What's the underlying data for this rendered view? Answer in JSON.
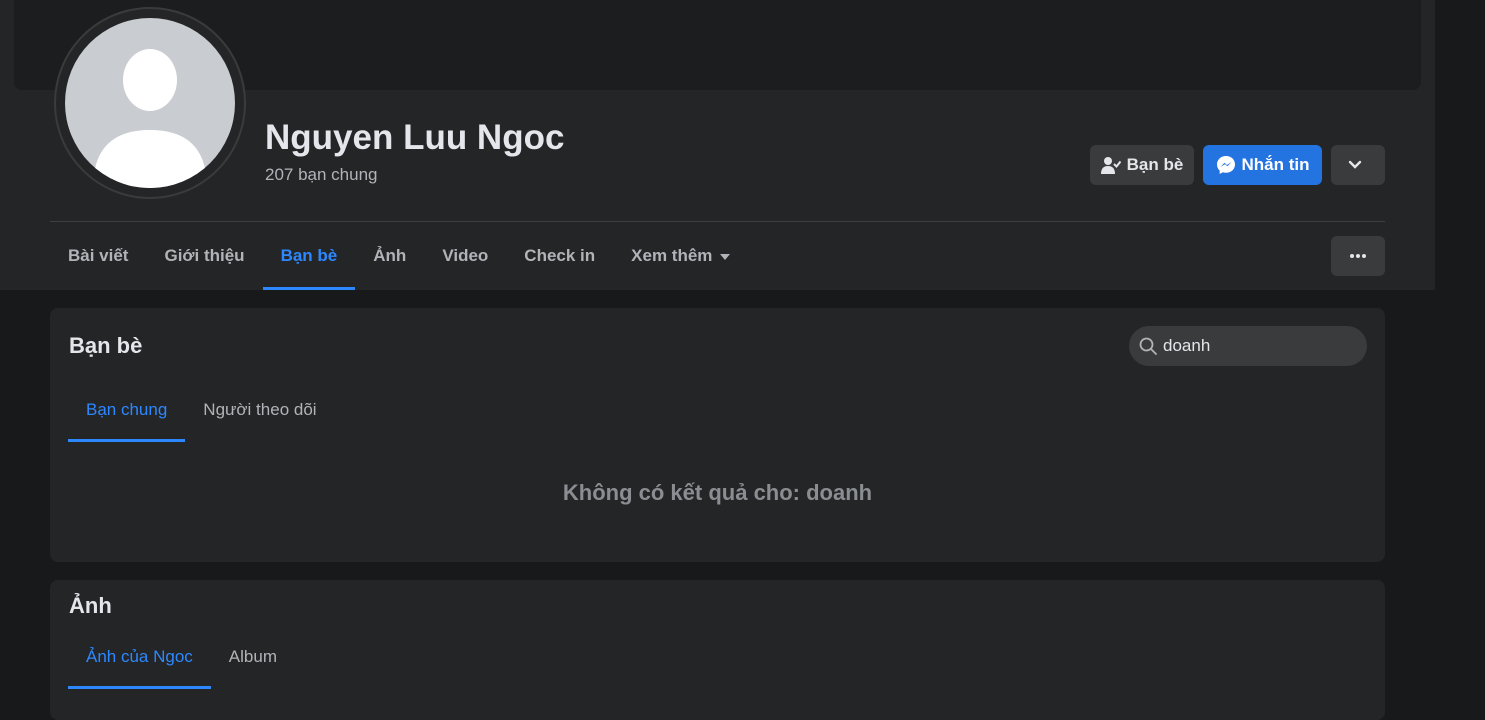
{
  "profile": {
    "name": "Nguyen Luu Ngoc",
    "mutual_friends": "207 bạn chung"
  },
  "actions": {
    "friends_label": "Bạn bè",
    "message_label": "Nhắn tin",
    "friends_icon": "user-check-icon",
    "message_icon": "messenger-icon",
    "more_icon": "chevron-down-icon",
    "accent_color": "#2374e1"
  },
  "nav": {
    "tabs": [
      {
        "label": "Bài viết"
      },
      {
        "label": "Giới thiệu"
      },
      {
        "label": "Bạn bè"
      },
      {
        "label": "Ảnh"
      },
      {
        "label": "Video"
      },
      {
        "label": "Check in"
      },
      {
        "label": "Xem thêm"
      }
    ],
    "active_tab": "Bạn bè",
    "overflow_icon": "more-dots-icon"
  },
  "friends_section": {
    "title": "Bạn bè",
    "search": {
      "value": "doanh",
      "icon": "search-icon"
    },
    "tabs": [
      {
        "label": "Bạn chung"
      },
      {
        "label": "Người theo dõi"
      }
    ],
    "active_tab": "Bạn chung",
    "no_results": "Không có kết quả cho: doanh"
  },
  "photos_section": {
    "title": "Ảnh",
    "tabs": [
      {
        "label": "Ảnh của Ngoc"
      },
      {
        "label": "Album"
      }
    ],
    "active_tab": "Ảnh của Ngoc"
  }
}
